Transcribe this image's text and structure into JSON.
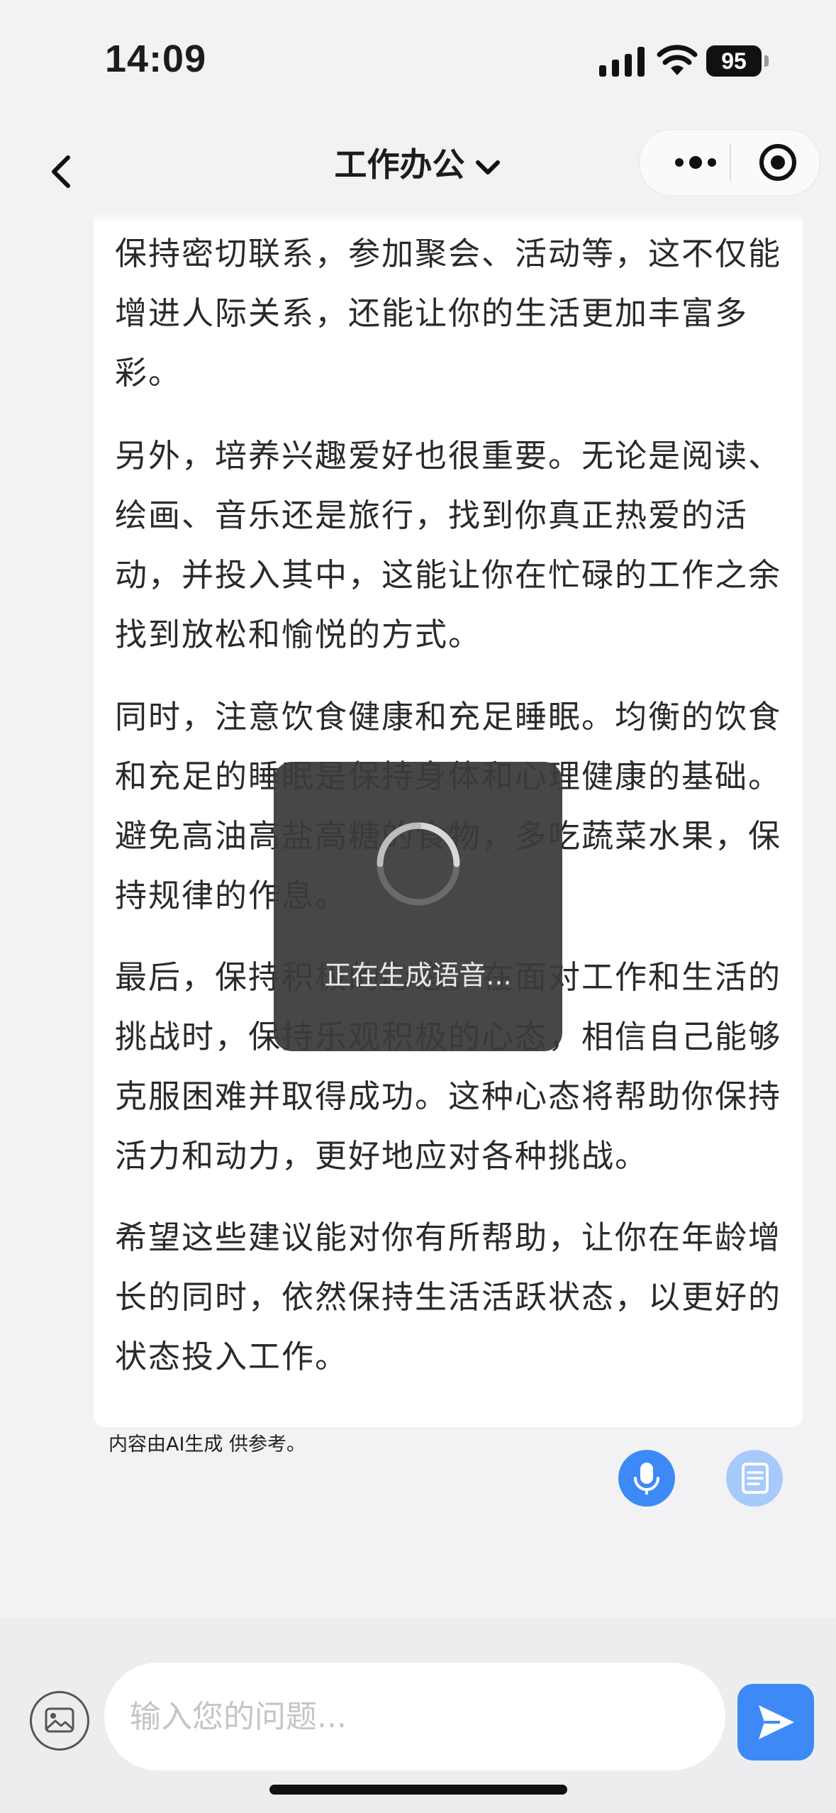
{
  "status_bar": {
    "time": "14:09",
    "battery": "95"
  },
  "nav": {
    "title": "工作办公"
  },
  "article": {
    "paragraphs": [
      "保持密切联系，参加聚会、活动等，这不仅能增进人际关系，还能让你的生活更加丰富多彩。",
      "另外，培养兴趣爱好也很重要。无论是阅读、绘画、音乐还是旅行，找到你真正热爱的活动，并投入其中，这能让你在忙碌的工作之余找到放松和愉悦的方式。",
      "同时，注意饮食健康和充足睡眠。均衡的饮食和充足的睡眠是保持身体和心理健康的基础。避免高油高盐高糖的食物，多吃蔬菜水果，保持规律的作息。",
      "最后，保持积极的心态。在面对工作和生活的挑战时，保持乐观积极的心态，相信自己能够克服困难并取得成功。这种心态将帮助你保持活力和动力，更好地应对各种挑战。",
      "希望这些建议能对你有所帮助，让你在年龄增长的同时，依然保持生活活跃状态，以更好的状态投入工作。"
    ]
  },
  "ai_note": "内容由AI生成 供参考。",
  "toast": {
    "text": "正在生成语音..."
  },
  "input": {
    "placeholder": "输入您的问题..."
  },
  "colors": {
    "accent": "#3d8af7",
    "accent_light": "#a7c9fb",
    "toast_bg": "#3c3c3e"
  },
  "icons": {
    "back": "chevron-left-icon",
    "title_dropdown": "chevron-down-icon",
    "more": "more-dots-icon",
    "close": "target-close-icon",
    "mic": "microphone-icon",
    "doc": "document-icon",
    "image": "image-icon",
    "send": "send-icon"
  }
}
